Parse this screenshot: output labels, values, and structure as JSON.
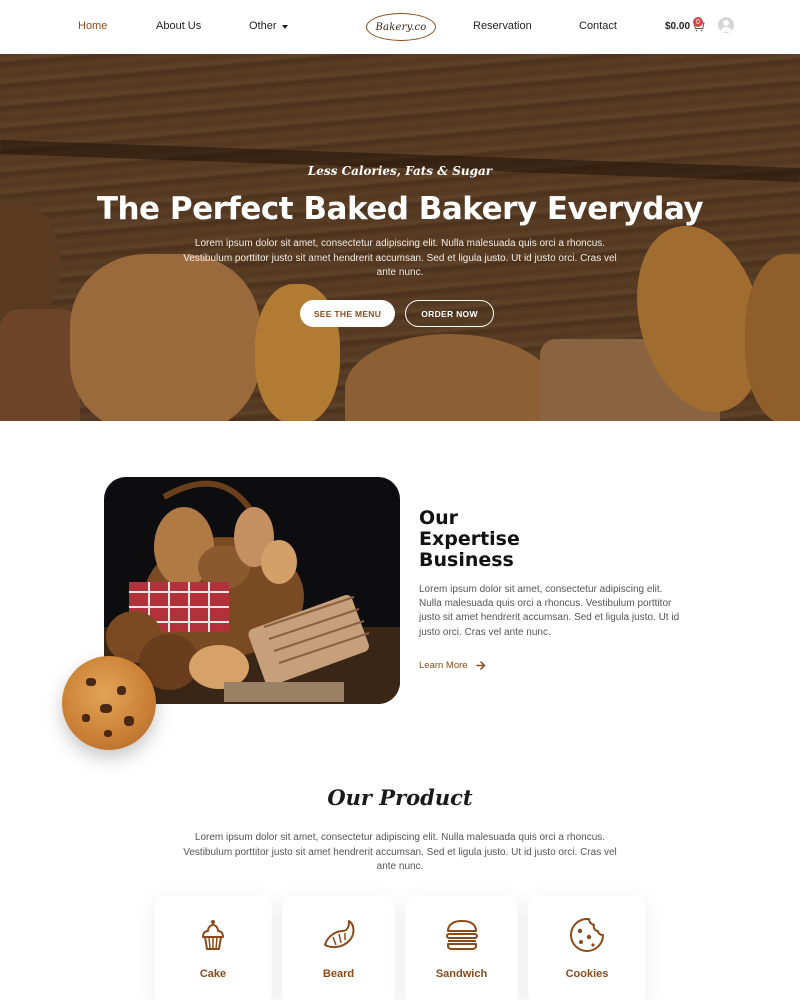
{
  "nav": {
    "home": "Home",
    "about": "About Us",
    "other": "Other",
    "logo": "Bakery.co",
    "reservation": "Reservation",
    "contact": "Contact",
    "cart_total": "$0.00",
    "cart_count": "0"
  },
  "hero": {
    "tagline": "Less Calories, Fats & Sugar",
    "title": "The Perfect Baked Bakery Everyday",
    "text": "Lorem ipsum dolor sit amet, consectetur adipiscing elit. Nulla malesuada quis orci a rhoncus. Vestibulum porttitor justo sit amet hendrerit accumsan. Sed et ligula justo. Ut id justo orci. Cras vel ante nunc.",
    "btn_menu": "SEE THE MENU",
    "btn_order": "ORDER NOW"
  },
  "expertise": {
    "title_l1": "Our",
    "title_l2": "Expertise",
    "title_l3": "Business",
    "text": "Lorem ipsum dolor sit amet, consectetur adipiscing elit. Nulla malesuada quis orci a rhoncus. Vestibulum porttitor justo sit amet hendrerit accumsan. Sed et ligula justo. Ut id justo orci. Cras vel ante nunc.",
    "learn_more": "Learn More"
  },
  "products": {
    "title": "Our Product",
    "text": "Lorem ipsum dolor sit amet, consectetur adipiscing elit. Nulla malesuada quis orci a rhoncus. Vestibulum porttitor justo sit amet hendrerit accumsan. Sed et ligula justo. Ut id justo orci. Cras vel ante nunc.",
    "items": [
      {
        "label": "Cake",
        "icon": "cupcake-icon"
      },
      {
        "label": "Beard",
        "icon": "croissant-icon"
      },
      {
        "label": "Sandwich",
        "icon": "burger-icon"
      },
      {
        "label": "Cookies",
        "icon": "cookie-icon"
      }
    ]
  },
  "colors": {
    "accent": "#8a4b1c",
    "text_dark": "#111111",
    "badge": "#d14a4a"
  }
}
